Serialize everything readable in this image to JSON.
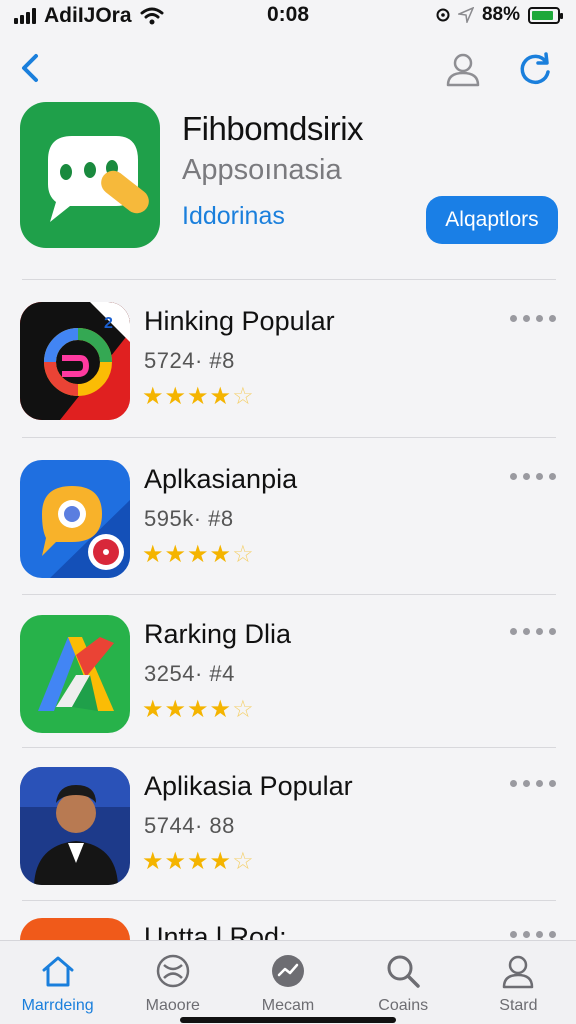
{
  "status_bar": {
    "carrier": "AdiIJOra",
    "time": "0:08",
    "battery": "88%",
    "battery_level": 0.88
  },
  "featured": {
    "title": "Fihbomdsirix",
    "subtitle": "Appsoınasia",
    "link": "Iddorinas",
    "button": "Alqaptlors"
  },
  "apps": [
    {
      "name": "Hinking Popular",
      "meta": "5724· #8",
      "rating": 4.5
    },
    {
      "name": "Aplkasianpia",
      "meta": "595k· #8",
      "rating": 4.5
    },
    {
      "name": "Rarking Dlia",
      "meta": "3254· #4",
      "rating": 4.5
    },
    {
      "name": "Aplikasia Popular",
      "meta": "5744· 88",
      "rating": 4.5
    },
    {
      "name": "Untta l Rod:",
      "meta": "",
      "rating": null
    }
  ],
  "tabs": [
    {
      "label": "Marrdeing",
      "icon": "home-icon",
      "active": true
    },
    {
      "label": "Maoore",
      "icon": "globe-icon",
      "active": false
    },
    {
      "label": "Mecam",
      "icon": "compass-icon",
      "active": false
    },
    {
      "label": "Coains",
      "icon": "search-icon",
      "active": false
    },
    {
      "label": "Stard",
      "icon": "person-icon",
      "active": false
    }
  ],
  "colors": {
    "accent": "#1a7fe6",
    "star": "#f4b400",
    "featured_icon_bg": "#1fa04a"
  }
}
